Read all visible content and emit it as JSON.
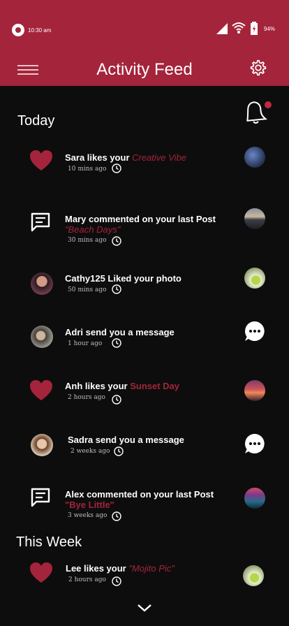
{
  "status": {
    "time": "10:30 am",
    "battery": "94%"
  },
  "header": {
    "title": "Activity Feed"
  },
  "sections": {
    "today": "Today",
    "this_week": "This Week"
  },
  "items": [
    {
      "pre": "Sara likes your ",
      "hl": "Creative Vibe",
      "ago": "10 mins ago",
      "icon": "heart-icon",
      "thumb": "creative-vibe-thumbnail"
    },
    {
      "pre": "Mary commented on your last Post",
      "second": "\"Beach Days\"",
      "ago": "30 mins ago",
      "icon": "comment-icon",
      "thumb": "beach-days-thumbnail"
    },
    {
      "pre": "Cathy125 Liked your photo",
      "ago": "50 mins ago",
      "icon": "cathy-avatar",
      "thumb": "drink-thumbnail"
    },
    {
      "pre": "Adri send you a message",
      "ago": "1 hour ago",
      "icon": "adri-avatar",
      "thumb": "message-bubble-icon"
    },
    {
      "pre": "Anh likes your ",
      "hl": "Sunset Day",
      "ago": "2 hours ago",
      "icon": "heart-icon",
      "thumb": "sunset-day-thumbnail"
    },
    {
      "pre": "Sadra send you a message",
      "ago": "2 weeks ago",
      "icon": "sadra-avatar",
      "thumb": "message-bubble-icon"
    },
    {
      "pre": "Alex commented on your last Post",
      "second": "\"Bye Little\"",
      "ago": "3 weeks ago",
      "icon": "comment-icon",
      "thumb": "bye-little-thumbnail"
    },
    {
      "pre": "Lee likes your ",
      "hl": "\"Mojito Pic\"",
      "ago": "2 hours ago",
      "icon": "heart-icon",
      "thumb": "mojito-thumbnail"
    }
  ],
  "colors": {
    "accent": "#a4243b",
    "background": "#0d0d0d"
  }
}
